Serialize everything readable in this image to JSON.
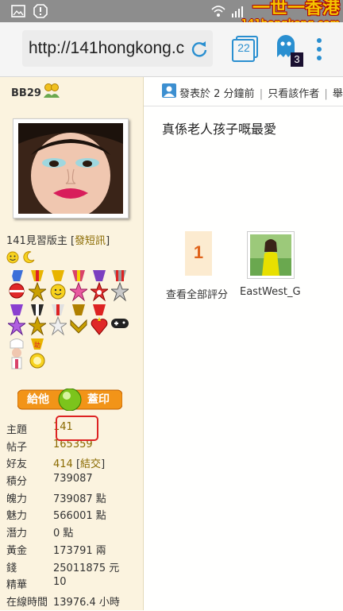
{
  "browser": {
    "url": "http://141hongkong.c",
    "tab_count": "22",
    "ghost_badge": "3"
  },
  "watermark": {
    "line1": "一世一香港",
    "line2": "141hongkong.com"
  },
  "profile": {
    "username": "BB29",
    "rank": "141見習版主",
    "sms_link": "發短訊",
    "stamp_button_left": "給他",
    "stamp_button_right": "蓋印",
    "stats": [
      {
        "label": "主題",
        "value": "141",
        "gold": true
      },
      {
        "label": "帖子",
        "value": "165359",
        "gold": true
      },
      {
        "label": "好友",
        "value": "414",
        "gold": true,
        "extra": "結交"
      },
      {
        "label": "積分",
        "value": "739087"
      },
      {
        "label": "魄力",
        "value": "739087 點"
      },
      {
        "label": "魅力",
        "value": "566001 點"
      },
      {
        "label": "潛力",
        "value": "0 點"
      },
      {
        "label": "黃金",
        "value": "173791 兩"
      },
      {
        "label": "錢",
        "value": "25011875 元"
      },
      {
        "label": "精華",
        "value": "10"
      },
      {
        "label": "在線時間",
        "value": "13976.4 小時"
      }
    ]
  },
  "post": {
    "posted": "發表於 2 分鐘前",
    "separator": "|",
    "author_only": "只看該作者",
    "more": "舉",
    "title": "真係老人孩子嘅最愛",
    "rating_count": "1",
    "rating_link": "查看全部評分",
    "rater_name": "EastWest_G"
  },
  "colors": {
    "accent_blue": "#2a8fd0",
    "gold_text": "#8a6a00",
    "highlight_red": "#dd2222",
    "sidebar_bg": "#fbf3df"
  }
}
